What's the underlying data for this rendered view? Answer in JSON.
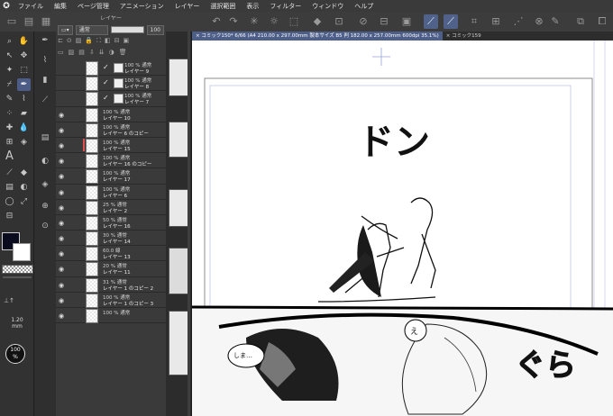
{
  "menu": [
    "ファイル",
    "編集",
    "ページ管理",
    "アニメーション",
    "レイヤー",
    "選択範囲",
    "表示",
    "フィルター",
    "ウィンドウ",
    "ヘルプ"
  ],
  "layer_panel": {
    "title": "レイヤー",
    "blend_mode": "通常",
    "opacity": "100",
    "layers": [
      {
        "line1": "100 % 通常",
        "line2": "レイヤー 9",
        "visible": false,
        "checked": true,
        "selected": false
      },
      {
        "line1": "100 % 通常",
        "line2": "レイヤー 8",
        "visible": false,
        "checked": true,
        "selected": false
      },
      {
        "line1": "100 % 通常",
        "line2": "レイヤー 7",
        "visible": false,
        "checked": true,
        "selected": false
      },
      {
        "line1": "100 % 通常",
        "line2": "レイヤー 10",
        "visible": true,
        "checked": false,
        "selected": false
      },
      {
        "line1": "100 % 通常",
        "line2": "レイヤー 6 のコピー",
        "visible": true,
        "checked": false,
        "selected": false
      },
      {
        "line1": "100 % 通常",
        "line2": "レイヤー 15",
        "visible": true,
        "checked": false,
        "selected": false,
        "marker": true
      },
      {
        "line1": "100 % 通常",
        "line2": "レイヤー 16 のコピー",
        "visible": true,
        "checked": false,
        "selected": false
      },
      {
        "line1": "100 % 通常",
        "line2": "レイヤー 17",
        "visible": true,
        "checked": false,
        "selected": false
      },
      {
        "line1": "100 % 通常",
        "line2": "レイヤー 6",
        "visible": true,
        "checked": false,
        "selected": false
      },
      {
        "line1": "25 % 通常",
        "line2": "レイヤー 2",
        "visible": true,
        "checked": false,
        "selected": false
      },
      {
        "line1": "50 % 通常",
        "line2": "レイヤー 16",
        "visible": true,
        "checked": false,
        "selected": false
      },
      {
        "line1": "30 % 通常",
        "line2": "レイヤー 14",
        "visible": true,
        "checked": false,
        "selected": false
      },
      {
        "line1": "60.0 線",
        "line2": "レイヤー 13",
        "visible": true,
        "checked": false,
        "selected": false
      },
      {
        "line1": "20 % 通常",
        "line2": "レイヤー 11",
        "visible": true,
        "checked": false,
        "selected": false
      },
      {
        "line1": "31 % 通常",
        "line2": "レイヤー 1 のコピー 2",
        "visible": true,
        "checked": false,
        "selected": false
      },
      {
        "line1": "100 % 通常",
        "line2": "レイヤー 1 のコピー 3",
        "visible": true,
        "checked": false,
        "selected": false
      },
      {
        "line1": "100 % 通常",
        "line2": "",
        "visible": true,
        "checked": false,
        "selected": false
      }
    ]
  },
  "brush_size": "1.20\nmm",
  "brush_opacity": "100\n%",
  "tabs": [
    {
      "label": "コミック150* 6/66 (A4 210.00 x 297.00mm 製本サイズ B5 判 182.00 x 257.00mm 600dpi 35.1%)",
      "active": true
    },
    {
      "label": "コミック159",
      "active": false
    }
  ],
  "canvas_text": {
    "sfx_don": "ドン",
    "sfx_gura": "ぐら",
    "bubble_e": "え",
    "bubble_shima": "しま…"
  },
  "colors": {
    "accent": "#4d5e88",
    "foreground": "#0b0b1e"
  }
}
